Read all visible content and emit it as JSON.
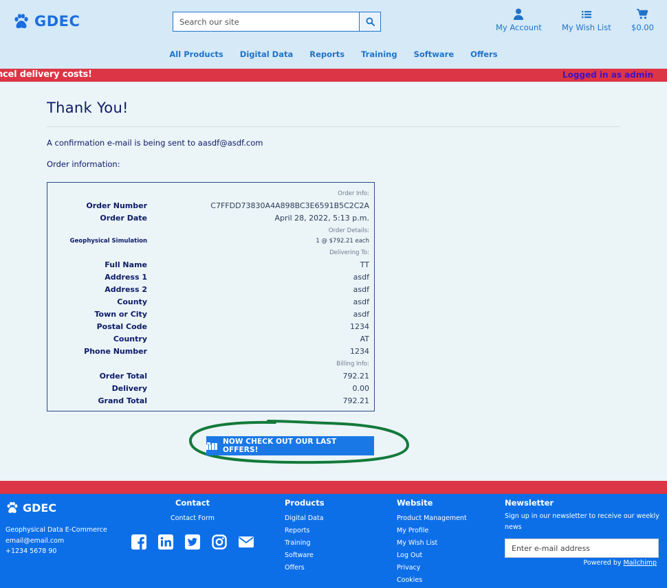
{
  "header": {
    "brand": "GDEC",
    "search_placeholder": "Search our site",
    "account_label": "My Account",
    "wishlist_label": "My Wish List",
    "cart_total": "$0.00",
    "nav": [
      "All Products",
      "Digital Data",
      "Reports",
      "Training",
      "Software",
      "Offers"
    ]
  },
  "banner": {
    "text": "ncel delivery costs!",
    "logged_in": "Logged in as admin"
  },
  "main": {
    "title": "Thank You!",
    "confirmation": "A confirmation e-mail is being sent to aasdf@asdf.com",
    "order_info_label": "Order information:",
    "sections": {
      "order_info": "Order Info:",
      "order_details": "Order Details:",
      "delivering_to": "Delivering To:",
      "billing_info": "Billing Info:"
    },
    "order": {
      "order_number_label": "Order Number",
      "order_number": "C7FFDD73830A4A898BC3E6591B5C2C2A",
      "order_date_label": "Order Date",
      "order_date": "April 28, 2022, 5:13 p.m.",
      "product_name": "Geophysical Simulation",
      "product_qty": "1 @ $792.21 each",
      "full_name_label": "Full Name",
      "full_name": "TT",
      "address1_label": "Address 1",
      "address1": "asdf",
      "address2_label": "Address 2",
      "address2": "asdf",
      "county_label": "County",
      "county": "asdf",
      "town_label": "Town or City",
      "town": "asdf",
      "postal_label": "Postal Code",
      "postal": "1234",
      "country_label": "Country",
      "country": "AT",
      "phone_label": "Phone Number",
      "phone": "1234",
      "order_total_label": "Order Total",
      "order_total": "792.21",
      "delivery_label": "Delivery",
      "delivery": "0.00",
      "grand_total_label": "Grand Total",
      "grand_total": "792.21"
    },
    "offer_button": "NOW CHECK OUT OUR LAST OFFERS!"
  },
  "footer": {
    "brand": "GDEC",
    "company": "Geophysical Data E-Commerce",
    "email": "email@email.com",
    "phone": "+1234 5678 90",
    "contact_title": "Contact",
    "contact_form": "Contact Form",
    "products_title": "Products",
    "products": [
      "Digital Data",
      "Reports",
      "Training",
      "Software",
      "Offers"
    ],
    "website_title": "Website",
    "website": [
      "Product Management",
      "My Profile",
      "My Wish List",
      "Log Out",
      "Privacy",
      "Cookies"
    ],
    "newsletter_title": "Newsletter",
    "newsletter_text": "Sign up in our newsletter to receive our weekly news",
    "newsletter_placeholder": "Enter e-mail address",
    "powered_prefix": "Powered by ",
    "powered_link": "Mailchimp"
  },
  "colors": {
    "header_bg": "#d6e9f7",
    "accent": "#1f73c9",
    "banner_red": "#dc3545",
    "footer_blue": "#0d6fe8",
    "highlight_ring": "#137a3a"
  }
}
